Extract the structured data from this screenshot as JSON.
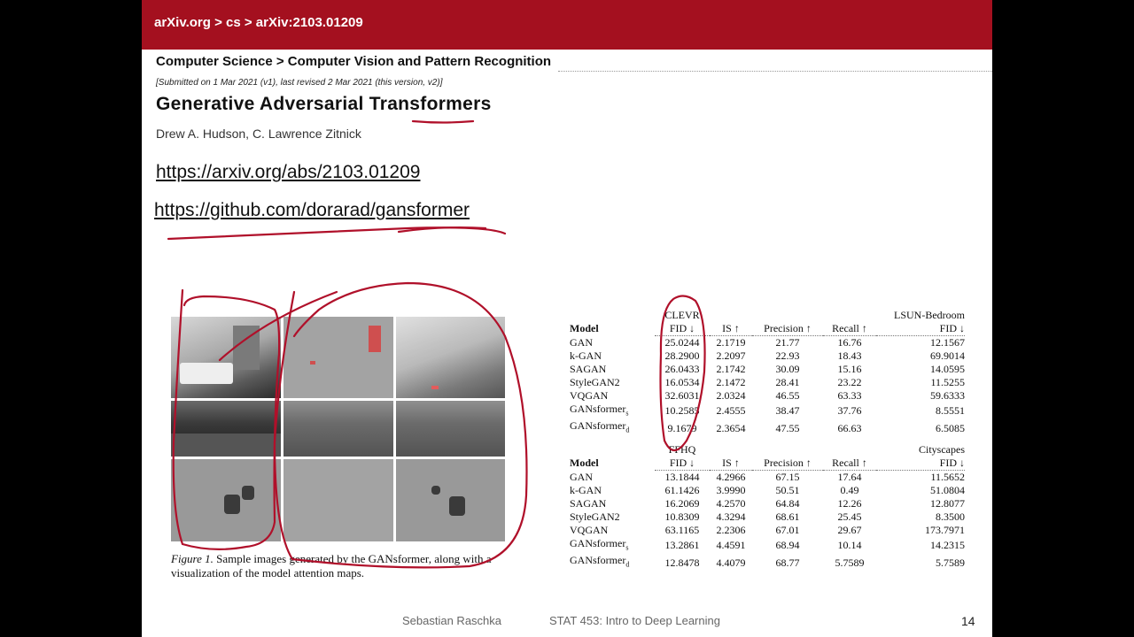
{
  "breadcrumb": "arXiv.org > cs > arXiv:2103.01209",
  "subject": "Computer Science > Computer Vision and Pattern Recognition",
  "submitted": "[Submitted on 1 Mar 2021 (v1), last revised 2 Mar 2021 (this version, v2)]",
  "paper_title": "Generative Adversarial Transformers",
  "authors": "Drew A. Hudson, C. Lawrence Zitnick",
  "links": [
    "https://arxiv.org/abs/2103.01209",
    "https://github.com/dorarad/gansformer"
  ],
  "figure": {
    "label": "Figure 1.",
    "caption": " Sample images generated by the GANsformer, along with a visualization of the model attention maps."
  },
  "tables": [
    {
      "left_dataset": "CLEVR",
      "right_dataset": "LSUN-Bedroom",
      "columns": [
        "Model",
        "FID ↓",
        "IS ↑",
        "Precision ↑",
        "Recall ↑",
        "FID ↓"
      ],
      "rows": [
        [
          "GAN",
          "25.0244",
          "2.1719",
          "21.77",
          "16.76",
          "12.1567"
        ],
        [
          "k-GAN",
          "28.2900",
          "2.2097",
          "22.93",
          "18.43",
          "69.9014"
        ],
        [
          "SAGAN",
          "26.0433",
          "2.1742",
          "30.09",
          "15.16",
          "14.0595"
        ],
        [
          "StyleGAN2",
          "16.0534",
          "2.1472",
          "28.41",
          "23.22",
          "11.5255"
        ],
        [
          "VQGAN",
          "32.6031",
          "2.0324",
          "46.55",
          "63.33",
          "59.6333"
        ],
        [
          "GANsformer",
          "10.2585",
          "2.4555",
          "38.47",
          "37.76",
          "8.5551"
        ],
        [
          "GANsformer",
          "9.1679",
          "2.3654",
          "47.55",
          "66.63",
          "6.5085"
        ]
      ]
    },
    {
      "left_dataset": "FFHQ",
      "right_dataset": "Cityscapes",
      "columns": [
        "Model",
        "FID ↓",
        "IS ↑",
        "Precision ↑",
        "Recall ↑",
        "FID ↓"
      ],
      "rows": [
        [
          "GAN",
          "13.1844",
          "4.2966",
          "67.15",
          "17.64",
          "11.5652"
        ],
        [
          "k-GAN",
          "61.1426",
          "3.9990",
          "50.51",
          "0.49",
          "51.0804"
        ],
        [
          "SAGAN",
          "16.2069",
          "4.2570",
          "64.84",
          "12.26",
          "12.8077"
        ],
        [
          "StyleGAN2",
          "10.8309",
          "4.3294",
          "68.61",
          "25.45",
          "8.3500"
        ],
        [
          "VQGAN",
          "63.1165",
          "2.2306",
          "67.01",
          "29.67",
          "173.7971"
        ],
        [
          "GANsformer",
          "13.2861",
          "4.4591",
          "68.94",
          "10.14",
          "14.2315"
        ],
        [
          "GANsformer",
          "12.8478",
          "4.4079",
          "68.77",
          "5.7589",
          "5.7589"
        ]
      ]
    }
  ],
  "model_subscripts": [
    "s",
    "d"
  ],
  "footer": {
    "author": "Sebastian Raschka",
    "course": "STAT 453: Intro to Deep Learning",
    "page": "14"
  },
  "colors": {
    "arxiv_red": "#a4101f",
    "ink_red": "#b0102a"
  }
}
